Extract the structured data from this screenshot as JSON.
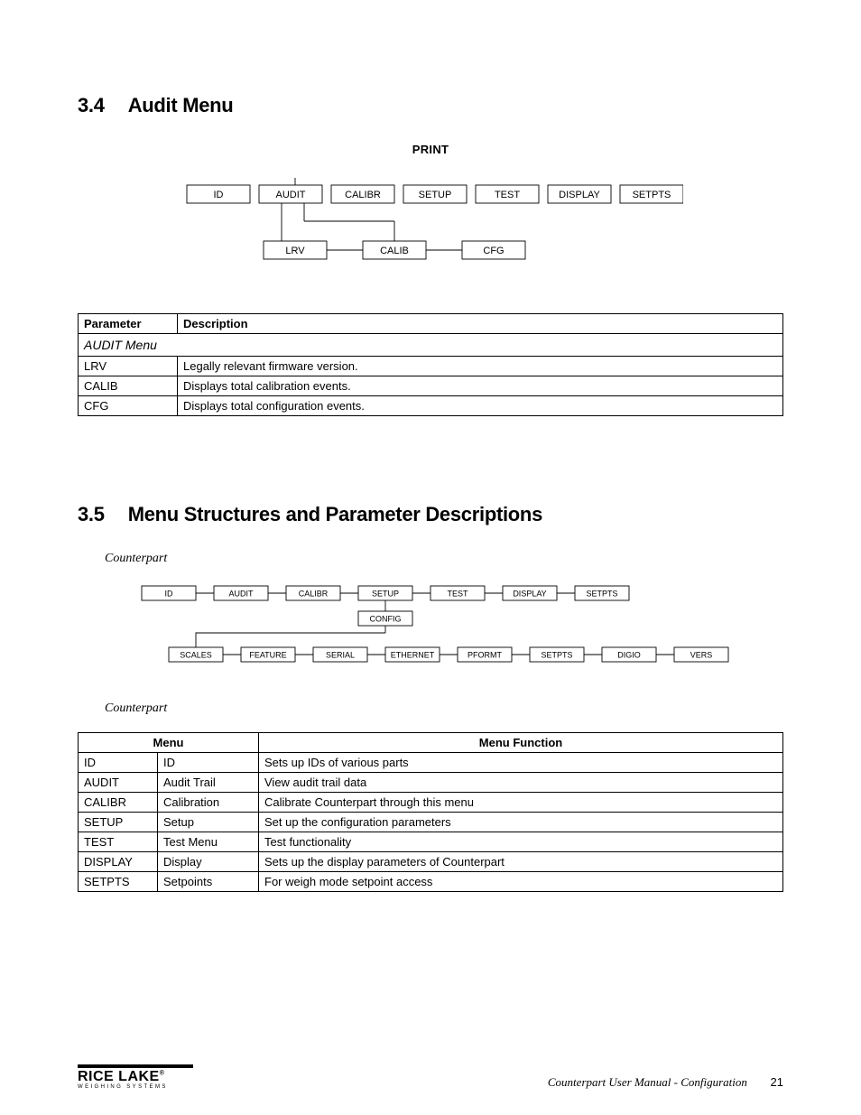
{
  "section34": {
    "num": "3.4",
    "title": "Audit Menu"
  },
  "section35": {
    "num": "3.5",
    "title": "Menu Structures and Parameter Descriptions",
    "subtitle": "Counterpart"
  },
  "fig1": {
    "root": "PRINT",
    "top": [
      "ID",
      "AUDIT",
      "CALIBR",
      "SETUP",
      "TEST",
      "DISPLAY",
      "SETPTS"
    ],
    "children": [
      "LRV",
      "CALIB",
      "CFG"
    ]
  },
  "fig2": {
    "subtitle": "Counterpart",
    "top": [
      "ID",
      "AUDIT",
      "CALIBR",
      "SETUP",
      "TEST",
      "DISPLAY",
      "SETPTS"
    ],
    "mid": "CONFIG",
    "bottom": [
      "SCALES",
      "FEATURE",
      "SERIAL",
      "ETHERNET",
      "PFORMT",
      "SETPTS",
      "DIGIO",
      "VERS"
    ]
  },
  "table1": {
    "caption": "AUDIT Menu",
    "headers": [
      "Parameter",
      "Description"
    ],
    "rows": [
      {
        "param": "LRV",
        "desc": "Legally relevant firmware version."
      },
      {
        "param": "CALIB",
        "desc": "Displays total calibration events."
      },
      {
        "param": "CFG",
        "desc": "Displays total configuration events."
      }
    ]
  },
  "table2": {
    "headers": [
      "Menu",
      "Menu Function"
    ],
    "rows": [
      {
        "a": "ID",
        "b": "ID",
        "c": "Sets up IDs of various parts"
      },
      {
        "a": "AUDIT",
        "b": "Audit Trail",
        "c": "View audit trail data"
      },
      {
        "a": "CALIBR",
        "b": "Calibration",
        "c": "Calibrate Counterpart through this menu"
      },
      {
        "a": "SETUP",
        "b": "Setup",
        "c": "Set up the configuration parameters"
      },
      {
        "a": "TEST",
        "b": "Test Menu",
        "c": "Test functionality"
      },
      {
        "a": "DISPLAY",
        "b": "Display",
        "c": "Sets up the display parameters of Counterpart"
      },
      {
        "a": "SETPTS",
        "b": "Setpoints",
        "c": "For weigh mode setpoint access"
      }
    ]
  },
  "footer": {
    "brand_main": "RICE LAKE",
    "brand_sub": "WEIGHING SYSTEMS",
    "doc": "Counterpart User Manual - Configuration",
    "page": "21"
  }
}
